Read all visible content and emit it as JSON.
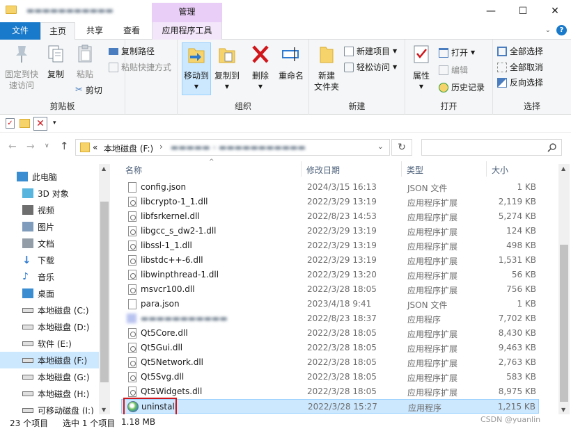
{
  "window": {
    "context_tab_label": "管理",
    "minimize": "—",
    "maximize": "☐",
    "close": "✕"
  },
  "tabs": {
    "file": "文件",
    "home": "主页",
    "share": "共享",
    "view": "查看",
    "app_tools": "应用程序工具"
  },
  "ribbon": {
    "clipboard": {
      "label": "剪贴板",
      "pin": "固定到快\n速访问",
      "copy": "复制",
      "paste": "粘贴",
      "copy_path": "复制路径",
      "paste_shortcut": "粘贴快捷方式",
      "cut": "剪切"
    },
    "organize": {
      "label": "组织",
      "move_to": "移动到",
      "copy_to": "复制到",
      "delete": "删除",
      "rename": "重命名"
    },
    "new": {
      "label": "新建",
      "new_folder": "新建\n文件夹",
      "new_item": "新建项目",
      "easy_access": "轻松访问"
    },
    "open": {
      "label": "打开",
      "properties": "属性",
      "open": "打开",
      "edit": "编辑",
      "history": "历史记录"
    },
    "select": {
      "label": "选择",
      "select_all": "全部选择",
      "select_none": "全部取消",
      "invert": "反向选择"
    }
  },
  "address": {
    "prefix": "«",
    "drive": "本地磁盘 (F:)",
    "sep": "›"
  },
  "nav": {
    "items": [
      {
        "label": "此电脑",
        "icon": "pc-icon"
      },
      {
        "label": "3D 对象",
        "icon": "cube-icon"
      },
      {
        "label": "视频",
        "icon": "video-icon"
      },
      {
        "label": "图片",
        "icon": "picture-icon"
      },
      {
        "label": "文档",
        "icon": "document-icon"
      },
      {
        "label": "下载",
        "icon": "download-icon"
      },
      {
        "label": "音乐",
        "icon": "music-icon"
      },
      {
        "label": "桌面",
        "icon": "desktop-icon"
      },
      {
        "label": "本地磁盘 (C:)",
        "icon": "drive-icon"
      },
      {
        "label": "本地磁盘 (D:)",
        "icon": "drive-icon"
      },
      {
        "label": "软件 (E:)",
        "icon": "drive-icon"
      },
      {
        "label": "本地磁盘 (F:)",
        "icon": "drive-icon"
      },
      {
        "label": "本地磁盘 (G:)",
        "icon": "drive-icon"
      },
      {
        "label": "本地磁盘 (H:)",
        "icon": "drive-icon"
      },
      {
        "label": "可移动磁盘 (I:)",
        "icon": "usb-drive-icon"
      }
    ]
  },
  "columns": {
    "name": "名称",
    "date": "修改日期",
    "type": "类型",
    "size": "大小"
  },
  "files": [
    {
      "name": "config.json",
      "date": "2024/3/15 16:13",
      "type": "JSON 文件",
      "size": "1 KB",
      "icon": "json"
    },
    {
      "name": "libcrypto-1_1.dll",
      "date": "2022/3/29 13:19",
      "type": "应用程序扩展",
      "size": "2,119 KB",
      "icon": "dll"
    },
    {
      "name": "libfsrkernel.dll",
      "date": "2022/8/23 14:53",
      "type": "应用程序扩展",
      "size": "5,274 KB",
      "icon": "dll"
    },
    {
      "name": "libgcc_s_dw2-1.dll",
      "date": "2022/3/29 13:19",
      "type": "应用程序扩展",
      "size": "124 KB",
      "icon": "dll"
    },
    {
      "name": "libssl-1_1.dll",
      "date": "2022/3/29 13:19",
      "type": "应用程序扩展",
      "size": "498 KB",
      "icon": "dll"
    },
    {
      "name": "libstdc++-6.dll",
      "date": "2022/3/29 13:19",
      "type": "应用程序扩展",
      "size": "1,531 KB",
      "icon": "dll"
    },
    {
      "name": "libwinpthread-1.dll",
      "date": "2022/3/29 13:20",
      "type": "应用程序扩展",
      "size": "56 KB",
      "icon": "dll"
    },
    {
      "name": "msvcr100.dll",
      "date": "2022/3/28 18:05",
      "type": "应用程序扩展",
      "size": "756 KB",
      "icon": "dll"
    },
    {
      "name": "para.json",
      "date": "2023/4/18 9:41",
      "type": "JSON 文件",
      "size": "1 KB",
      "icon": "json"
    },
    {
      "name": "",
      "date": "2022/8/23 18:37",
      "type": "应用程序",
      "size": "7,702 KB",
      "icon": "exe-blurred"
    },
    {
      "name": "Qt5Core.dll",
      "date": "2022/3/28 18:05",
      "type": "应用程序扩展",
      "size": "8,430 KB",
      "icon": "dll"
    },
    {
      "name": "Qt5Gui.dll",
      "date": "2022/3/28 18:05",
      "type": "应用程序扩展",
      "size": "9,463 KB",
      "icon": "dll"
    },
    {
      "name": "Qt5Network.dll",
      "date": "2022/3/28 18:05",
      "type": "应用程序扩展",
      "size": "2,763 KB",
      "icon": "dll"
    },
    {
      "name": "Qt5Svg.dll",
      "date": "2022/3/28 18:05",
      "type": "应用程序扩展",
      "size": "583 KB",
      "icon": "dll"
    },
    {
      "name": "Qt5Widgets.dll",
      "date": "2022/3/28 18:05",
      "type": "应用程序扩展",
      "size": "8,975 KB",
      "icon": "dll"
    },
    {
      "name": "uninstall",
      "date": "2022/3/28 15:27",
      "type": "应用程序",
      "size": "1,215 KB",
      "icon": "exe",
      "selected": true
    }
  ],
  "status": {
    "count": "23 个项目",
    "selected": "选中 1 个项目",
    "size": "1.18 MB"
  },
  "watermark": "CSDN @yuanlin",
  "colors": {
    "file_tab": "#1979ca",
    "selection": "#cce8ff",
    "highlight_box": "#d0161b"
  }
}
